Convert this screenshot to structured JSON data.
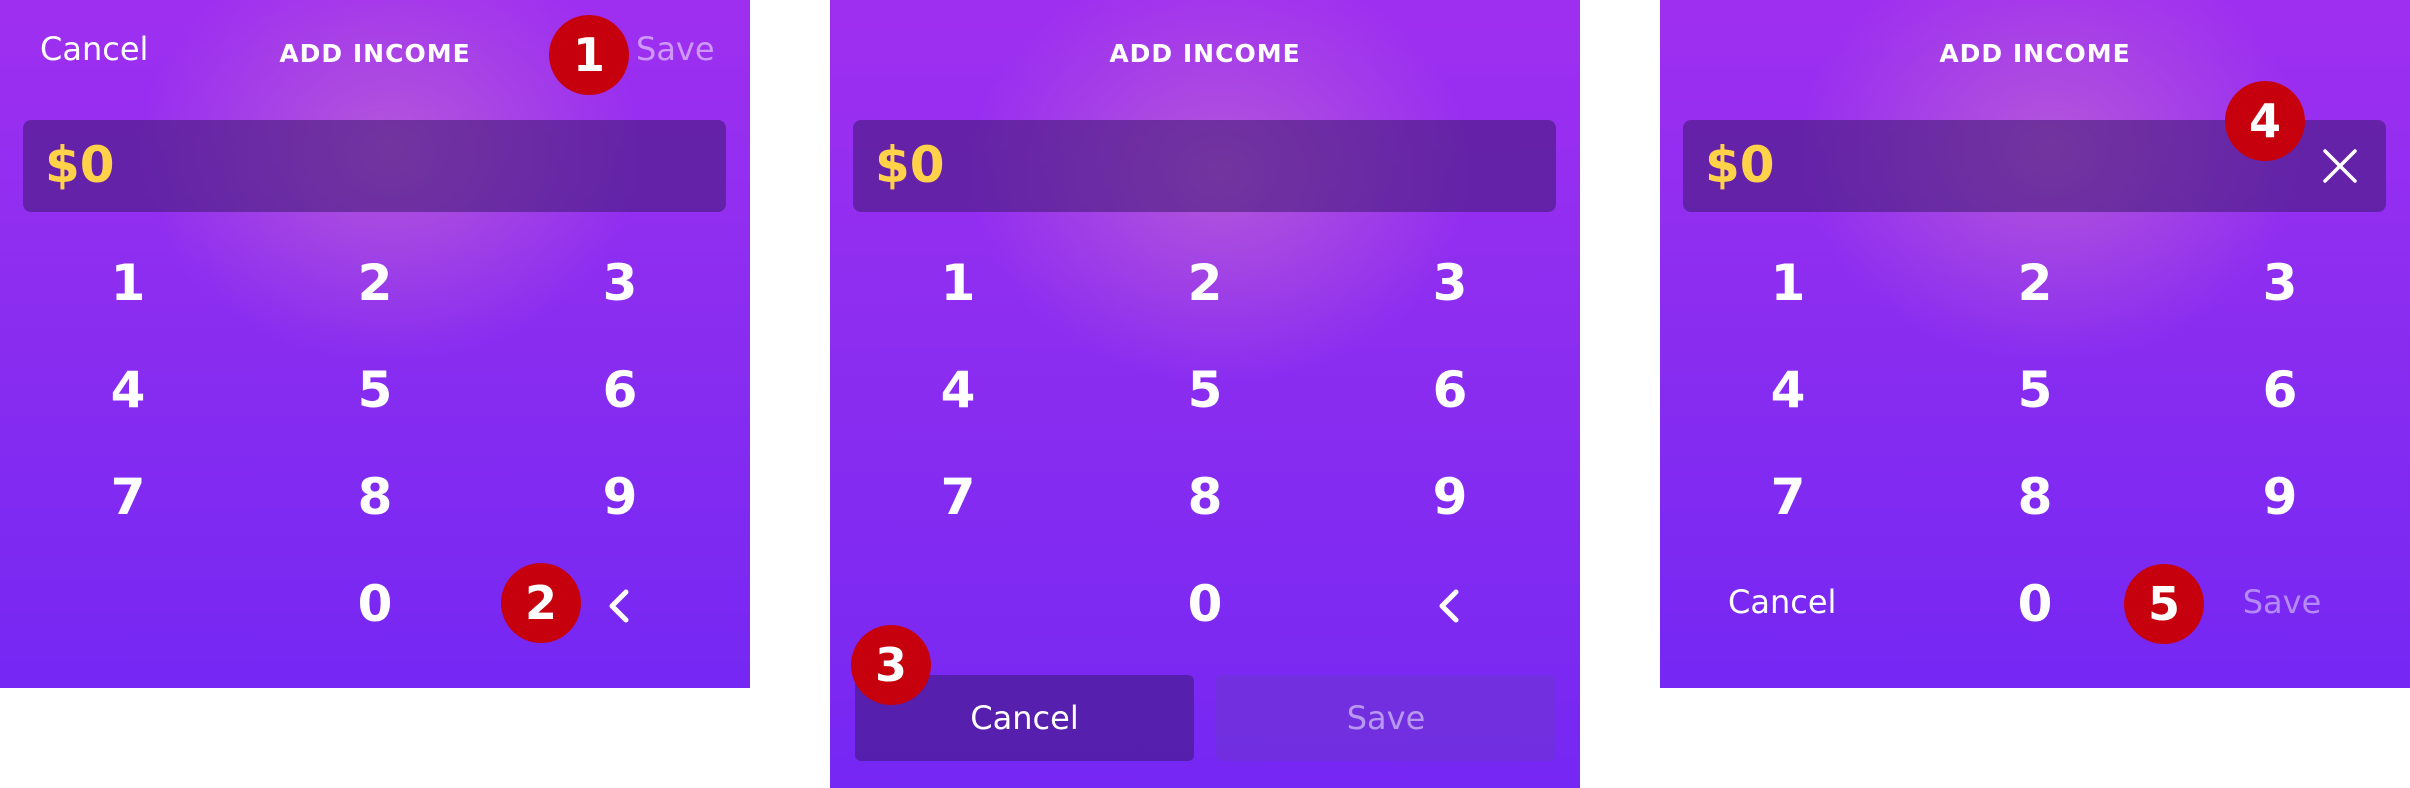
{
  "panel1": {
    "cancel_label": "Cancel",
    "title": "ADD INCOME",
    "save_label": "Save",
    "amount": "$0",
    "keys": [
      "1",
      "2",
      "3",
      "4",
      "5",
      "6",
      "7",
      "8",
      "9",
      "0"
    ],
    "badges": [
      "1",
      "2"
    ]
  },
  "panel2": {
    "title": "ADD INCOME",
    "amount": "$0",
    "keys": [
      "1",
      "2",
      "3",
      "4",
      "5",
      "6",
      "7",
      "8",
      "9",
      "0"
    ],
    "cancel_button": "Cancel",
    "save_button": "Save",
    "badges": [
      "3"
    ]
  },
  "panel3": {
    "title": "ADD INCOME",
    "amount": "$0",
    "keys": [
      "1",
      "2",
      "3",
      "4",
      "5",
      "6",
      "7",
      "8",
      "9",
      "0"
    ],
    "cancel_label": "Cancel",
    "save_label": "Save",
    "badges": [
      "4",
      "5"
    ]
  },
  "icons": {
    "backspace": "chevron-left-icon",
    "clear": "close-icon"
  },
  "colors": {
    "amount_text": "#ffd24a",
    "badge": "#c6000c",
    "background_top": "#9f2ff0",
    "background_bottom": "#7527f3"
  }
}
